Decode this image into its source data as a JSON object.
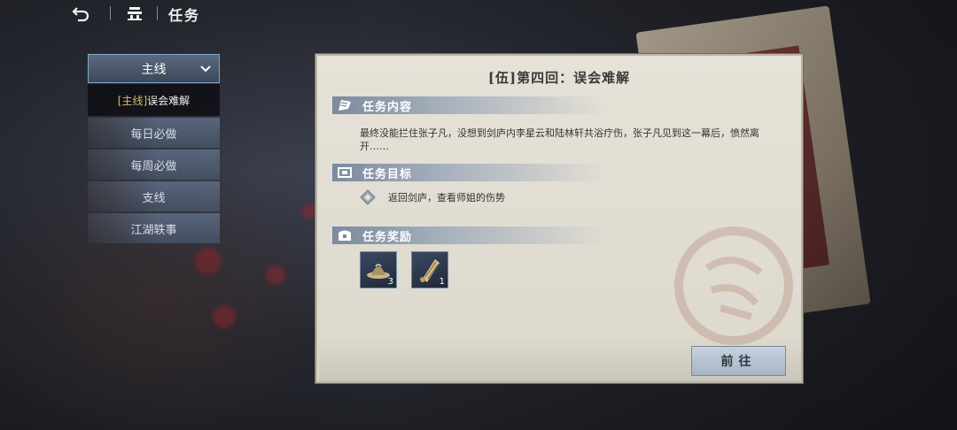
{
  "header": {
    "title": "任务"
  },
  "menu": {
    "main_label": "主线",
    "sub_item": {
      "tag": "[主线]",
      "label": "误会难解"
    },
    "items": [
      {
        "label": "每日必做"
      },
      {
        "label": "每周必做"
      },
      {
        "label": "支线"
      },
      {
        "label": "江湖轶事"
      }
    ]
  },
  "quest": {
    "title": "[伍]第四回：误会难解",
    "content_header": "任务内容",
    "description": "最终没能拦住张子凡，没想到剑庐内李星云和陆林轩共浴疗伤，张子凡见到这一幕后，愤然离开……",
    "goal_header": "任务目标",
    "goal_text": "返回剑庐，查看师姐的伤势",
    "reward_header": "任务奖励",
    "rewards": [
      {
        "icon": "hat-icon",
        "count": "3"
      },
      {
        "icon": "scroll-icon",
        "count": "1"
      }
    ],
    "go_button": "前往"
  },
  "colors": {
    "panel_bg": "#e6e2d8",
    "section_bar": "#7b8a9e",
    "menu_active_border": "#7ea7c9",
    "tag_gold": "#d8b86a"
  }
}
